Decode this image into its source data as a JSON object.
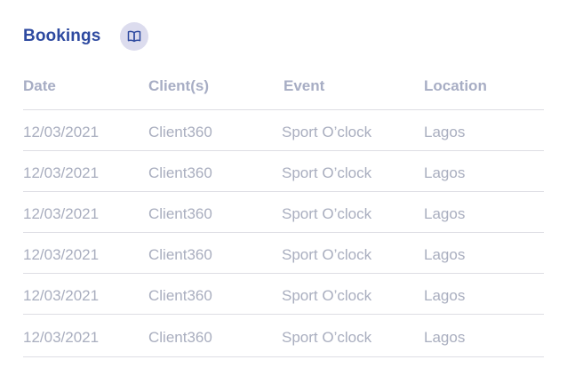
{
  "header": {
    "title": "Bookings",
    "icon": "book-open-icon"
  },
  "colors": {
    "title": "#2e4aa0",
    "header_text": "#a7adc4",
    "cell_text": "#a9aebf",
    "icon_bg": "#dcdcee",
    "divider": "#dedee4"
  },
  "table": {
    "columns": [
      "Date",
      "Client(s)",
      "Event",
      "Location"
    ],
    "rows": [
      {
        "date": "12/03/2021",
        "client": "Client360",
        "event": "Sport O’clock",
        "location": "Lagos"
      },
      {
        "date": "12/03/2021",
        "client": "Client360",
        "event": "Sport O’clock",
        "location": "Lagos"
      },
      {
        "date": "12/03/2021",
        "client": "Client360",
        "event": "Sport O’clock",
        "location": "Lagos"
      },
      {
        "date": "12/03/2021",
        "client": "Client360",
        "event": "Sport O’clock",
        "location": "Lagos"
      },
      {
        "date": "12/03/2021",
        "client": "Client360",
        "event": "Sport O’clock",
        "location": "Lagos"
      },
      {
        "date": "12/03/2021",
        "client": "Client360",
        "event": "Sport O’clock",
        "location": "Lagos"
      }
    ]
  }
}
